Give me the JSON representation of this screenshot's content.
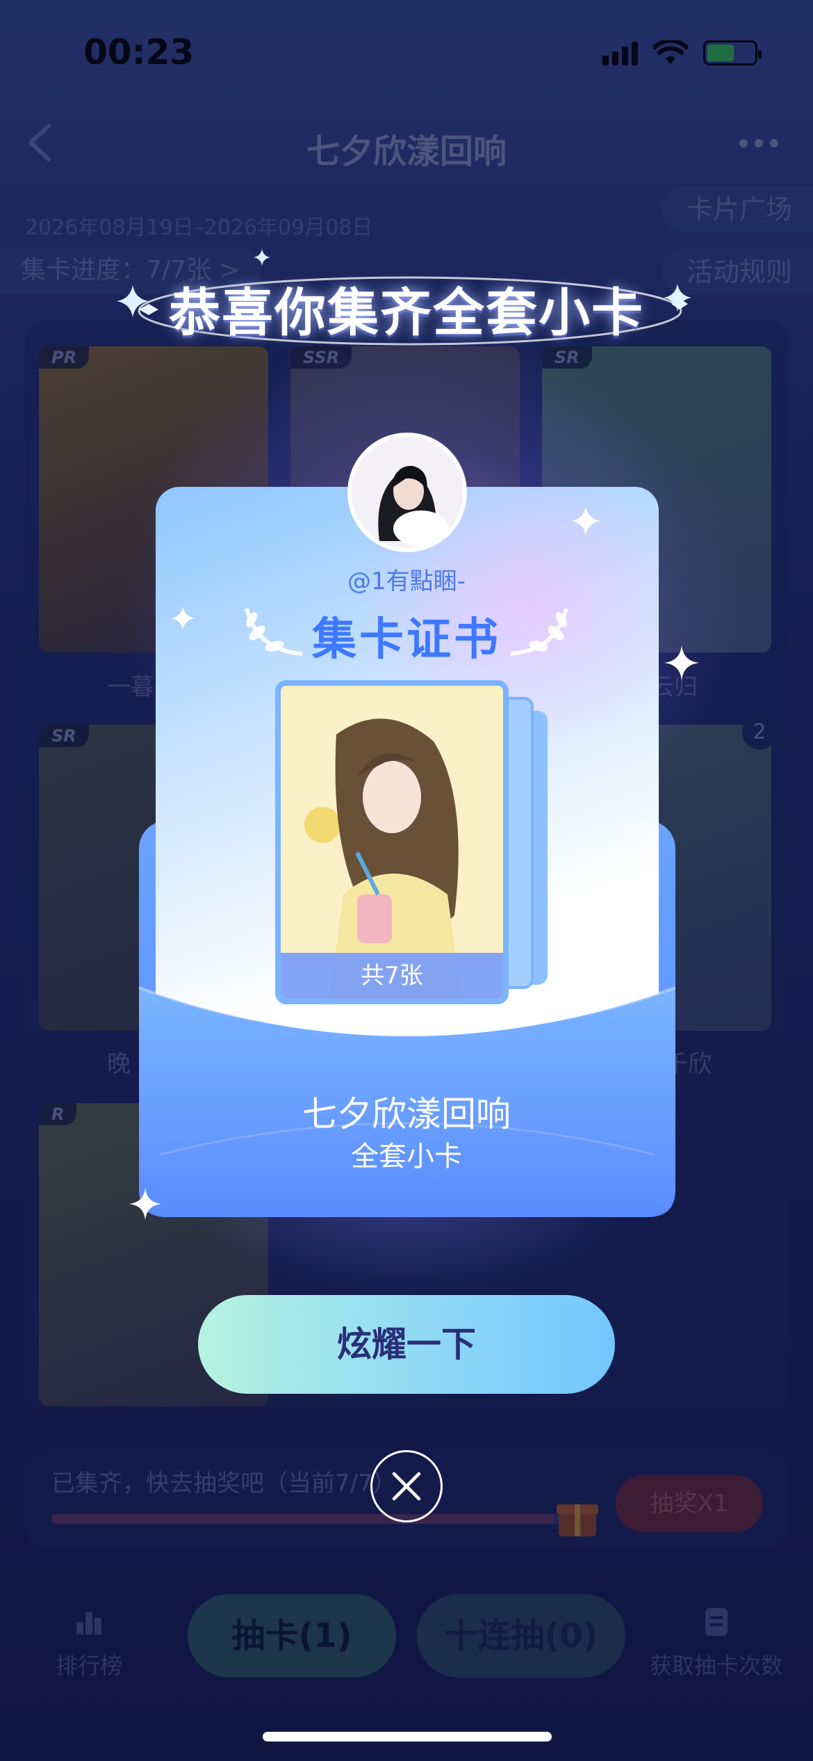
{
  "status_bar": {
    "time": "00:23"
  },
  "nav": {
    "title": "七夕欣漾回响"
  },
  "event": {
    "date_range": "2026年08月19日–2026年09月08日",
    "progress": "集卡进度：7/7张 >",
    "card_plaza": "卡片广场",
    "rules": "活动规则"
  },
  "cards": [
    {
      "rarity": "PR",
      "name": "一暮"
    },
    {
      "rarity": "SSR",
      "name": ""
    },
    {
      "rarity": "SR",
      "name": "云归"
    },
    {
      "rarity": "SR",
      "name": "晚"
    },
    {
      "rarity": "",
      "name": "",
      "count": "2"
    },
    {
      "rarity": "",
      "name": "千欣"
    },
    {
      "rarity": "R",
      "name": ""
    }
  ],
  "draw": {
    "text": "已集齐，快去抽奖吧（当前7/7）",
    "button": "抽奖X1",
    "progress_fraction": 0.95
  },
  "tabbar": {
    "ranking": "排行榜",
    "draw_one": "抽卡(1)",
    "draw_ten": "十连抽(0)",
    "get_chances": "获取抽卡次数"
  },
  "modal": {
    "headline": "恭喜你集齐全套小卡",
    "username": "@1有點睏-",
    "certificate_title": "集卡证书",
    "card_count": "共7张",
    "series_name": "七夕欣漾回响",
    "series_sub": "全套小卡",
    "share_button": "炫耀一下"
  },
  "colors": {
    "accent_blue": "#3d78ff",
    "share_gradient_start": "#b5f3df",
    "share_gradient_end": "#74c6ff",
    "envelope": "#5b8fff"
  }
}
